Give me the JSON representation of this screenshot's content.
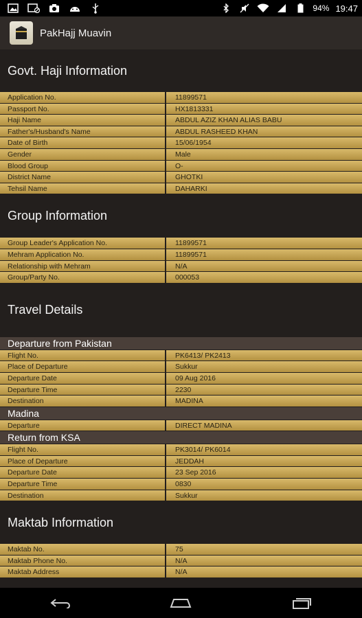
{
  "status_bar": {
    "battery": "94%",
    "time": "19:47"
  },
  "app": {
    "title": "PakHajj Muavin"
  },
  "haji_info": {
    "title": "Govt. Haji Information",
    "rows": [
      {
        "label": "Application No.",
        "value": "11899571"
      },
      {
        "label": "Passport No.",
        "value": "HX1813331"
      },
      {
        "label": "Haji Name",
        "value": "ABDUL AZIZ KHAN ALIAS BABU"
      },
      {
        "label": "Father's/Husband's Name",
        "value": "ABDUL RASHEED KHAN"
      },
      {
        "label": "Date of Birth",
        "value": "15/06/1954"
      },
      {
        "label": "Gender",
        "value": "Male"
      },
      {
        "label": "Blood Group",
        "value": "O-"
      },
      {
        "label": "District Name",
        "value": "GHOTKI"
      },
      {
        "label": "Tehsil Name",
        "value": "DAHARKI"
      }
    ]
  },
  "group_info": {
    "title": "Group Information",
    "rows": [
      {
        "label": "Group Leader's Application No.",
        "value": "11899571"
      },
      {
        "label": "Mehram Application No.",
        "value": "11899571"
      },
      {
        "label": "Relationship with Mehram",
        "value": "N/A"
      },
      {
        "label": "Group/Party No.",
        "value": "000053"
      }
    ]
  },
  "travel": {
    "title": "Travel Details",
    "departure": {
      "header": "Departure from Pakistan",
      "rows": [
        {
          "label": "Flight No.",
          "value": "PK6413/ PK2413"
        },
        {
          "label": "Place of Departure",
          "value": "Sukkur"
        },
        {
          "label": "Departure Date",
          "value": "09 Aug 2016"
        },
        {
          "label": "Departure Time",
          "value": "2230"
        },
        {
          "label": "Destination",
          "value": "MADINA"
        }
      ]
    },
    "madina": {
      "header": "Madina",
      "rows": [
        {
          "label": "Departure",
          "value": "DIRECT MADINA"
        }
      ]
    },
    "return": {
      "header": "Return from KSA",
      "rows": [
        {
          "label": "Flight No.",
          "value": "PK3014/ PK6014"
        },
        {
          "label": "Place of Departure",
          "value": "JEDDAH"
        },
        {
          "label": "Departure Date",
          "value": "23 Sep 2016"
        },
        {
          "label": "Departure Time",
          "value": "0830"
        },
        {
          "label": "Destination",
          "value": "Sukkur"
        }
      ]
    }
  },
  "maktab": {
    "title": "Maktab Information",
    "rows": [
      {
        "label": "Maktab No.",
        "value": "75"
      },
      {
        "label": "Maktab Phone No.",
        "value": "N/A"
      },
      {
        "label": "Maktab Address",
        "value": "N/A"
      }
    ]
  }
}
